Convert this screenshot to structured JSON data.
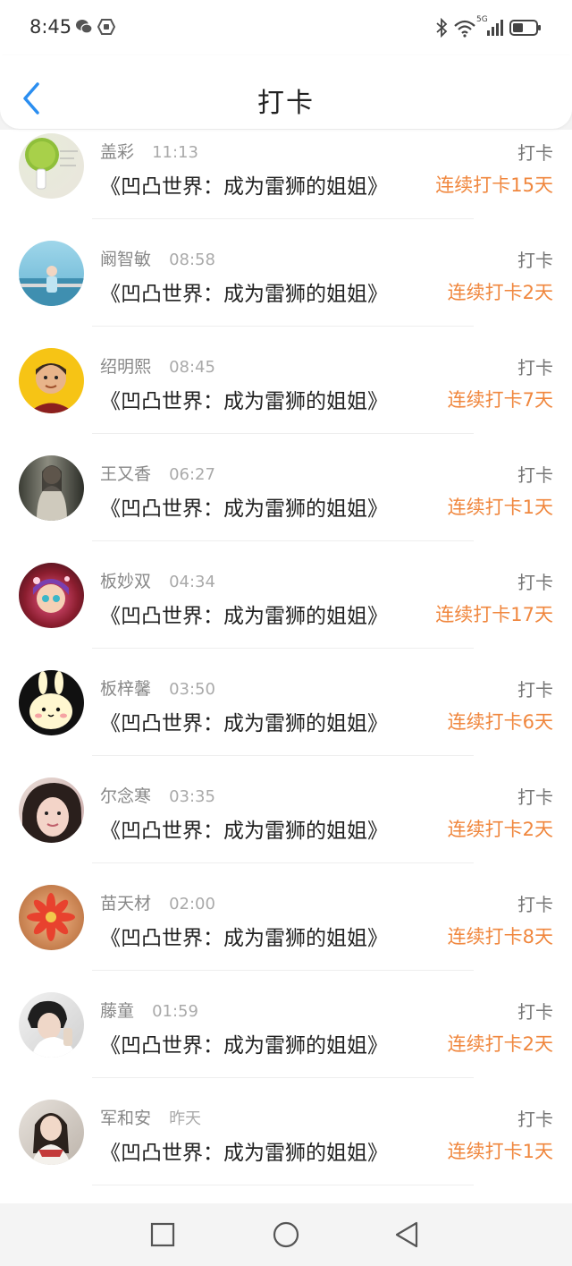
{
  "status_bar": {
    "time": "8:45",
    "left_icons": [
      "wechat-icon",
      "shield-notification-icon"
    ],
    "right_icons": [
      "bluetooth-icon",
      "wifi-icon",
      "signal-5g-icon",
      "battery-icon"
    ],
    "network_label": "5G"
  },
  "header": {
    "title": "打卡",
    "back_icon": "chevron-left-icon"
  },
  "colors": {
    "accent_blue": "#2b8ef0",
    "streak_orange": "#f0873e"
  },
  "checkins": [
    {
      "name": "盖彩",
      "time": "11:13",
      "book": "《凹凸世界：成为雷狮的姐姐》",
      "action": "打卡",
      "streak": "连续打卡15天"
    },
    {
      "name": "阚智敏",
      "time": "08:58",
      "book": "《凹凸世界：成为雷狮的姐姐》",
      "action": "打卡",
      "streak": "连续打卡2天"
    },
    {
      "name": "绍明熙",
      "time": "08:45",
      "book": "《凹凸世界：成为雷狮的姐姐》",
      "action": "打卡",
      "streak": "连续打卡7天"
    },
    {
      "name": "王又香",
      "time": "06:27",
      "book": "《凹凸世界：成为雷狮的姐姐》",
      "action": "打卡",
      "streak": "连续打卡1天"
    },
    {
      "name": "板妙双",
      "time": "04:34",
      "book": "《凹凸世界：成为雷狮的姐姐》",
      "action": "打卡",
      "streak": "连续打卡17天"
    },
    {
      "name": "板梓馨",
      "time": "03:50",
      "book": "《凹凸世界：成为雷狮的姐姐》",
      "action": "打卡",
      "streak": "连续打卡6天"
    },
    {
      "name": "尔念寒",
      "time": "03:35",
      "book": "《凹凸世界：成为雷狮的姐姐》",
      "action": "打卡",
      "streak": "连续打卡2天"
    },
    {
      "name": "苗天材",
      "time": "02:00",
      "book": "《凹凸世界：成为雷狮的姐姐》",
      "action": "打卡",
      "streak": "连续打卡8天"
    },
    {
      "name": "藤童",
      "time": "01:59",
      "book": "《凹凸世界：成为雷狮的姐姐》",
      "action": "打卡",
      "streak": "连续打卡2天"
    },
    {
      "name": "军和安",
      "time": "昨天",
      "book": "《凹凸世界：成为雷狮的姐姐》",
      "action": "打卡",
      "streak": "连续打卡1天"
    }
  ],
  "nav_bar": {
    "buttons": [
      "recent-apps-square-icon",
      "home-circle-icon",
      "back-triangle-icon"
    ]
  }
}
